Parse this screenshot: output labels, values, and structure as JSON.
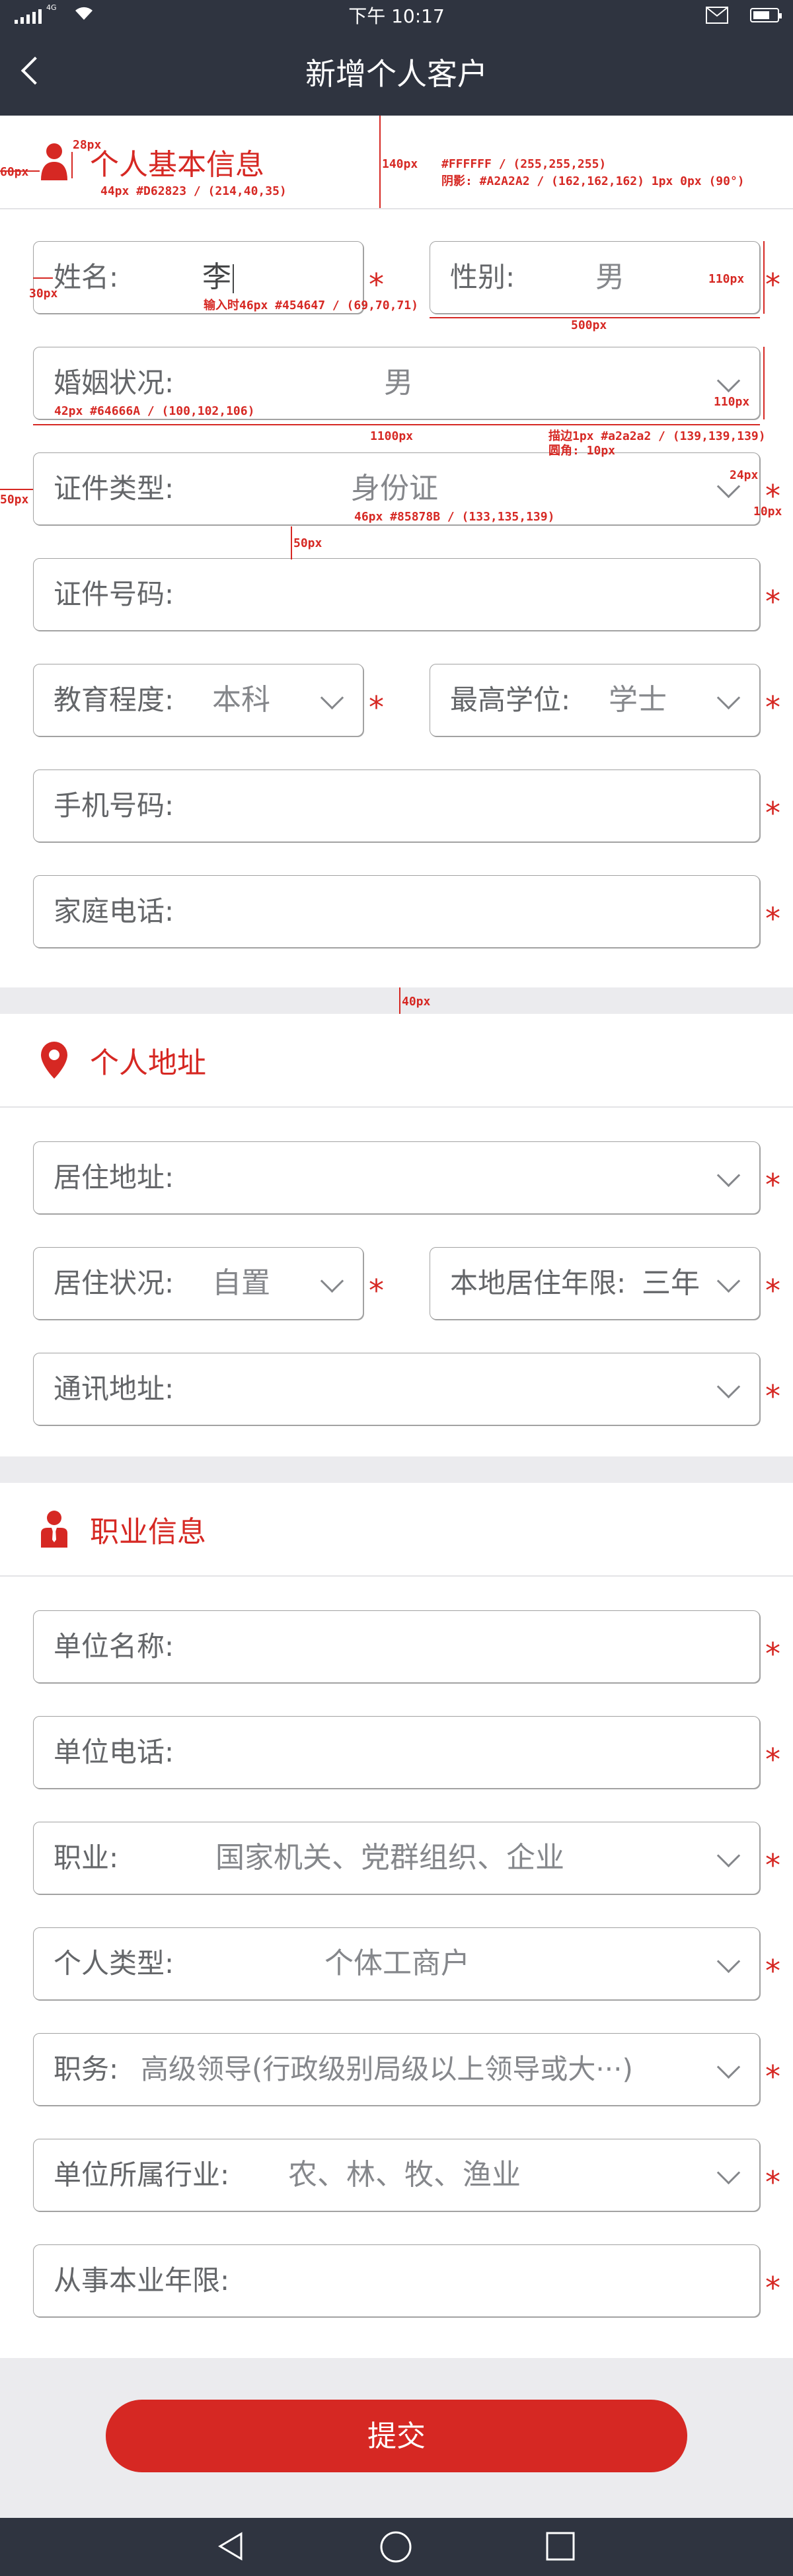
{
  "status_bar": {
    "network": "4G",
    "time": "下午 10:17"
  },
  "header": {
    "title": "新增个人客户"
  },
  "section_basic": {
    "title": "个人基本信息"
  },
  "section_address": {
    "title": "个人地址"
  },
  "section_job": {
    "title": "职业信息"
  },
  "fields": {
    "name": {
      "label": "姓名:",
      "value": "李"
    },
    "gender": {
      "label": "性别:",
      "value": "男"
    },
    "marital": {
      "label": "婚姻状况:",
      "value": "男"
    },
    "id_type": {
      "label": "证件类型:",
      "value": "身份证"
    },
    "id_number": {
      "label": "证件号码:",
      "value": ""
    },
    "education": {
      "label": "教育程度:",
      "value": "本科"
    },
    "degree": {
      "label": "最高学位:",
      "value": "学士"
    },
    "mobile": {
      "label": "手机号码:",
      "value": ""
    },
    "home_phone": {
      "label": "家庭电话:",
      "value": ""
    },
    "residence_address": {
      "label": "居住地址:",
      "value": ""
    },
    "residence_status": {
      "label": "居住状况:",
      "value": "自置"
    },
    "local_years": {
      "label": "本地居住年限:",
      "value": "三年"
    },
    "mail_address": {
      "label": "通讯地址:",
      "value": ""
    },
    "company_name": {
      "label": "单位名称:",
      "value": ""
    },
    "company_phone": {
      "label": "单位电话:",
      "value": ""
    },
    "occupation": {
      "label": "职业:",
      "value": "国家机关、党群组织、企业"
    },
    "personal_type": {
      "label": "个人类型:",
      "value": "个体工商户"
    },
    "position": {
      "label": "职务:",
      "value": "高级领导(行政级别局级以上领导或大···)"
    },
    "industry": {
      "label": "单位所属行业:",
      "value": "农、林、牧、渔业"
    },
    "years_in_industry": {
      "label": "从事本业年限:",
      "value": ""
    }
  },
  "required_mark": "*",
  "submit_label": "提交",
  "annotations": {
    "a28": "28px",
    "a60": "60px",
    "a44": "44px #D62823 / (214,40,35)",
    "a140": "140px",
    "a_bg": "#FFFFFF / (255,255,255)",
    "a_shadow": "阴影: #A2A2A2 / (162,162,162) 1px 0px (90°)",
    "a30": "30px",
    "a_input": "输入时46px #454647 / (69,70,71)",
    "a110a": "110px",
    "a500": "500px",
    "a110b": "110px",
    "a42": "42px #64666A / (100,102,106)",
    "a1100": "1100px",
    "a_border": "描边1px #a2a2a2 / (139,139,139)",
    "a_radius": "圆角: 10px",
    "a50a": "50px",
    "a46": "46px #85878B / (133,135,139)",
    "a24": "24px",
    "a10": "10px",
    "a50b": "50px",
    "a40": "40px"
  },
  "colors": {
    "accent": "#D62823",
    "header_bg": "#2F3440",
    "border": "#A2A2A2",
    "label": "#64666A",
    "value": "#85878B",
    "input": "#454647"
  }
}
